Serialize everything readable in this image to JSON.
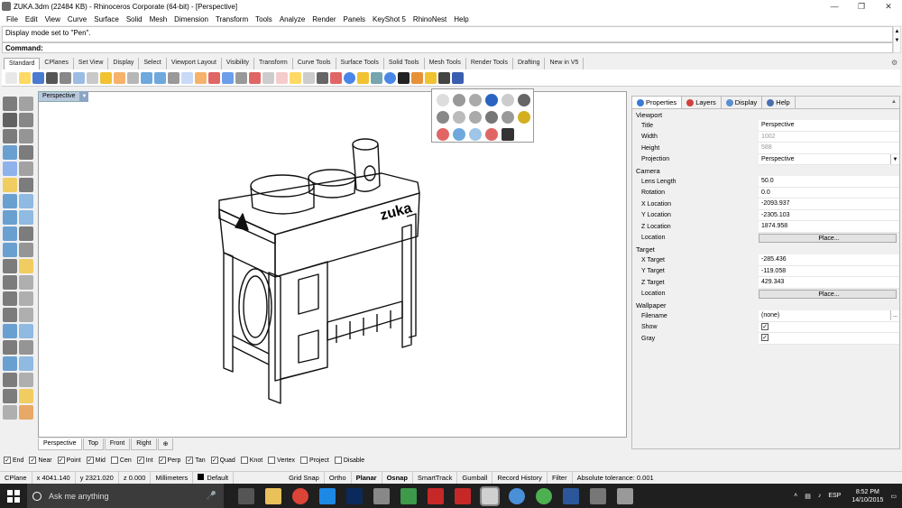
{
  "window": {
    "title": "ZUKA.3dm (22484 KB) - Rhinoceros Corporate (64-bit) - [Perspective]",
    "controls": [
      "—",
      "❐",
      "✕"
    ]
  },
  "menu": [
    "File",
    "Edit",
    "View",
    "Curve",
    "Surface",
    "Solid",
    "Mesh",
    "Dimension",
    "Transform",
    "Tools",
    "Analyze",
    "Render",
    "Panels",
    "KeyShot 5",
    "RhinoNest",
    "Help"
  ],
  "command": {
    "history": "Display mode set to \"Pen\".",
    "prompt": "Command:"
  },
  "toolbar_tabs": [
    "Standard",
    "CPlanes",
    "Set View",
    "Display",
    "Select",
    "Viewport Layout",
    "Visibility",
    "Transform",
    "Curve Tools",
    "Surface Tools",
    "Solid Tools",
    "Mesh Tools",
    "Render Tools",
    "Drafting",
    "New in V5"
  ],
  "viewport": {
    "label": "Perspective",
    "brand_text": "zuka",
    "tabs": [
      "Perspective",
      "Top",
      "Front",
      "Right"
    ]
  },
  "osnap": {
    "items": [
      {
        "label": "End",
        "checked": true
      },
      {
        "label": "Near",
        "checked": true
      },
      {
        "label": "Point",
        "checked": true
      },
      {
        "label": "Mid",
        "checked": true
      },
      {
        "label": "Cen",
        "checked": false
      },
      {
        "label": "Int",
        "checked": true
      },
      {
        "label": "Perp",
        "checked": true
      },
      {
        "label": "Tan",
        "checked": true
      },
      {
        "label": "Quad",
        "checked": true
      },
      {
        "label": "Knot",
        "checked": false
      },
      {
        "label": "Vertex",
        "checked": false
      },
      {
        "label": "Project",
        "checked": false
      },
      {
        "label": "Disable",
        "checked": false
      }
    ]
  },
  "status": {
    "cplane": "CPlane",
    "x": "x 4041.140",
    "y": "y 2321.020",
    "z": "z 0.000",
    "units": "Millimeters",
    "layer": "Default",
    "grid_snap": "Grid Snap",
    "ortho": "Ortho",
    "planar": "Planar",
    "osnap": "Osnap",
    "smarttrack": "SmartTrack",
    "gumball": "Gumball",
    "record_history": "Record History",
    "filter": "Filter",
    "tolerance": "Absolute tolerance: 0.001"
  },
  "properties": {
    "tabs": [
      "Properties",
      "Layers",
      "Display",
      "Help"
    ],
    "sections": {
      "viewport": "Viewport",
      "camera": "Camera",
      "target": "Target",
      "wallpaper": "Wallpaper"
    },
    "viewport_rows": [
      {
        "label": "Title",
        "value": "Perspective"
      },
      {
        "label": "Width",
        "value": "1002"
      },
      {
        "label": "Height",
        "value": "588"
      },
      {
        "label": "Projection",
        "value": "Perspective"
      }
    ],
    "camera_rows": [
      {
        "label": "Lens Length",
        "value": "50.0"
      },
      {
        "label": "Rotation",
        "value": "0.0"
      },
      {
        "label": "X Location",
        "value": "-2093.937"
      },
      {
        "label": "Y Location",
        "value": "-2305.103"
      },
      {
        "label": "Z Location",
        "value": "1874.958"
      },
      {
        "label": "Location",
        "value": "Place..."
      }
    ],
    "target_rows": [
      {
        "label": "X Target",
        "value": "-285.436"
      },
      {
        "label": "Y Target",
        "value": "-119.058"
      },
      {
        "label": "Z Target",
        "value": "429.343"
      },
      {
        "label": "Location",
        "value": "Place..."
      }
    ],
    "wallpaper_rows": [
      {
        "label": "Filename",
        "value": "(none)"
      },
      {
        "label": "Show",
        "value": ""
      },
      {
        "label": "Gray",
        "value": ""
      }
    ]
  },
  "taskbar": {
    "search_placeholder": "Ask me anything",
    "lang": "ESP",
    "time": "8:52 PM",
    "date": "14/10/2015"
  }
}
